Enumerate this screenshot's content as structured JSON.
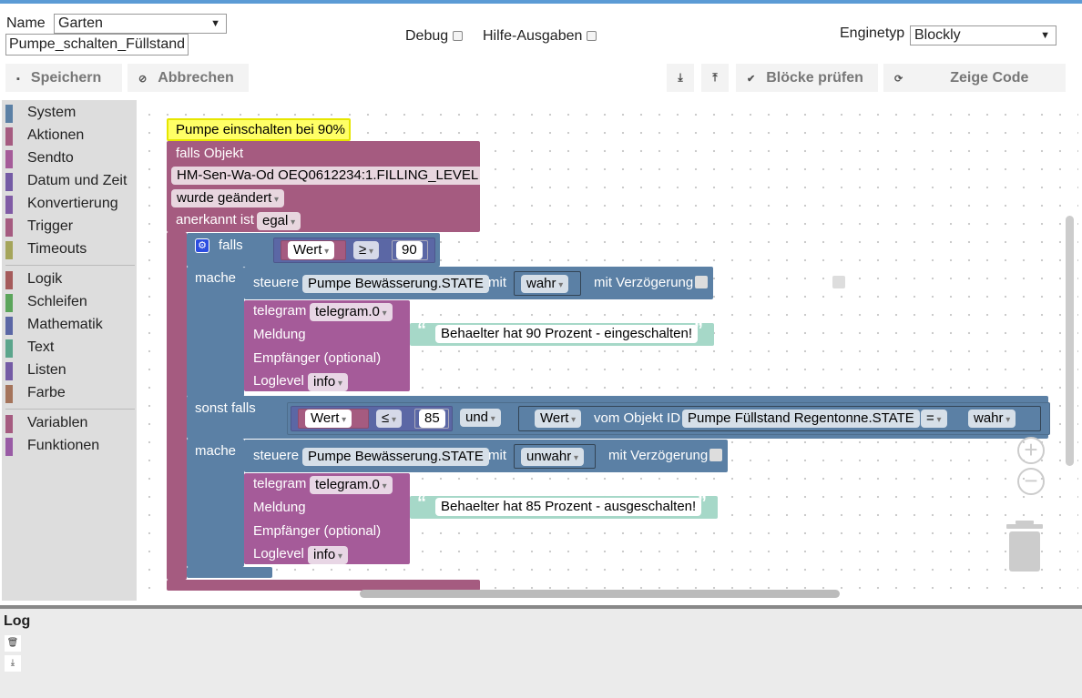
{
  "header": {
    "name_label": "Name",
    "folder_value": "Garten",
    "script_name_value": "Pumpe_schalten_Füllstand",
    "debug_label": "Debug",
    "help_label": "Hilfe-Ausgaben",
    "engine_label": "Enginetyp",
    "engine_value": "Blockly"
  },
  "toolbar": {
    "save_label": "Speichern",
    "cancel_label": "Abbrechen",
    "check_label": "Blöcke prüfen",
    "code_label": "Zeige Code",
    "export_icon": "download-icon",
    "import_icon": "upload-icon"
  },
  "toolbox": {
    "categories": [
      {
        "label": "System",
        "color": "#5b80a5"
      },
      {
        "label": "Aktionen",
        "color": "#a55b80"
      },
      {
        "label": "Sendto",
        "color": "#a55b99"
      },
      {
        "label": "Datum und Zeit",
        "color": "#745ba5"
      },
      {
        "label": "Konvertierung",
        "color": "#805ba5"
      },
      {
        "label": "Trigger",
        "color": "#a55b80"
      },
      {
        "label": "Timeouts",
        "color": "#a5a55b"
      },
      {
        "label": "Logik",
        "color": "#a55b5b"
      },
      {
        "label": "Schleifen",
        "color": "#5ba55b"
      },
      {
        "label": "Mathematik",
        "color": "#5b67a5"
      },
      {
        "label": "Text",
        "color": "#5ba58c"
      },
      {
        "label": "Listen",
        "color": "#745ba5"
      },
      {
        "label": "Farbe",
        "color": "#a5745b"
      },
      {
        "label": "Variablen",
        "color": "#a55b80"
      },
      {
        "label": "Funktionen",
        "color": "#995ba5"
      }
    ]
  },
  "workspace": {
    "comment": "Pumpe einschalten bei 90%",
    "trigger": {
      "title": "falls Objekt",
      "object_id": "HM-Sen-Wa-Od OEQ0612234:1.FILLING_LEVEL",
      "condition": "wurde geändert",
      "ack_label": "anerkannt ist",
      "ack_value": "egal"
    },
    "if_block": {
      "if_label": "falls",
      "do_label": "mache",
      "elseif_label": "sonst falls",
      "do2_label": "mache"
    },
    "cond1": {
      "var": "Wert",
      "op": "≥",
      "num": "90"
    },
    "action1": {
      "control_label": "steuere",
      "object": "Pumpe Bewässerung.STATE",
      "with_label": "mit",
      "value": "wahr",
      "delay_label": "mit Verzögerung"
    },
    "telegram1": {
      "title": "telegram",
      "instance": "telegram.0",
      "message_label": "Meldung",
      "message": "Behaelter hat 90 Prozent - eingeschalten!",
      "recipient_label": "Empfänger (optional)",
      "loglevel_label": "Loglevel",
      "loglevel": "info"
    },
    "cond2": {
      "var": "Wert",
      "op": "≤",
      "num": "85",
      "and_label": "und",
      "var2": "Wert",
      "from_label": "vom Objekt ID",
      "object": "Pumpe Füllstand Regentonne.STATE",
      "eq": "=",
      "value": "wahr"
    },
    "action2": {
      "control_label": "steuere",
      "object": "Pumpe Bewässerung.STATE",
      "with_label": "mit",
      "value": "unwahr",
      "delay_label": "mit Verzögerung"
    },
    "telegram2": {
      "title": "telegram",
      "instance": "telegram.0",
      "message_label": "Meldung",
      "message": "Behaelter hat 85 Prozent - ausgeschalten!",
      "recipient_label": "Empfänger (optional)",
      "loglevel_label": "Loglevel",
      "loglevel": "info"
    }
  },
  "log": {
    "title": "Log",
    "clear_icon": "trash-icon",
    "download_icon": "download-icon"
  }
}
